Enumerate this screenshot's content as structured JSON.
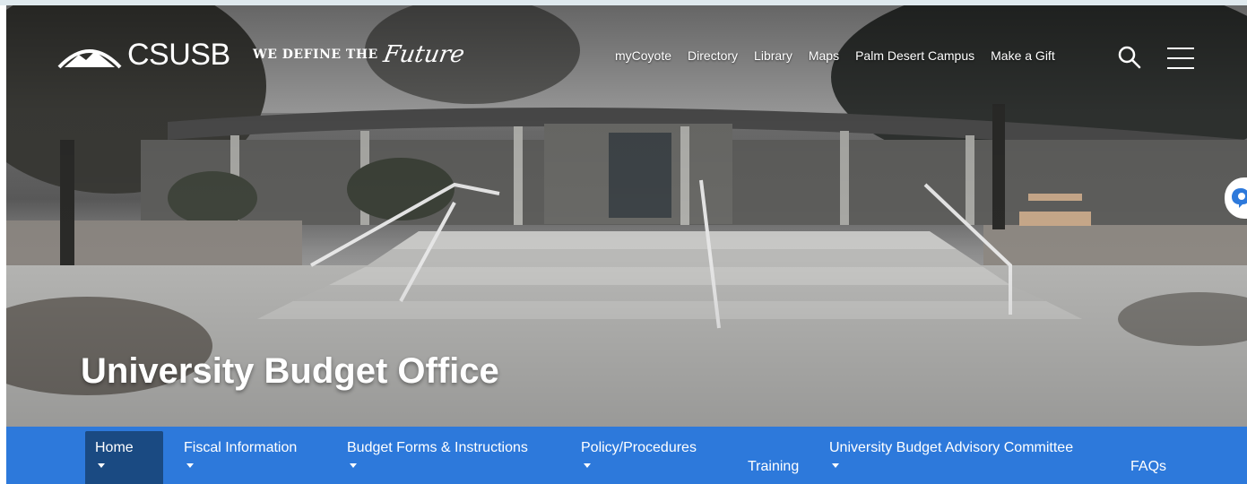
{
  "header": {
    "logo_text": "CSUSB",
    "tagline_main": "WE DEFINE THE",
    "tagline_script": "Future",
    "top_links": [
      "myCoyote",
      "Directory",
      "Library",
      "Maps",
      "Palm Desert Campus",
      "Make a Gift"
    ],
    "search_icon": "search-icon",
    "menu_icon": "hamburger-menu-icon"
  },
  "hero": {
    "title": "University Budget Office"
  },
  "main_nav": {
    "items": [
      {
        "label": "Home",
        "dropdown": true,
        "active": true
      },
      {
        "label": "Fiscal Information",
        "dropdown": true
      },
      {
        "label": "Budget Forms & Instructions",
        "dropdown": true
      },
      {
        "label": "Policy/Procedures",
        "dropdown": true
      },
      {
        "label": "Training",
        "dropdown": false
      },
      {
        "label": "University Budget Advisory Committee",
        "dropdown": true
      },
      {
        "label": "FAQs",
        "dropdown": false
      }
    ]
  },
  "colors": {
    "nav_bar": "#2d79db",
    "nav_active": "#1a4a82",
    "text": "#ffffff"
  }
}
